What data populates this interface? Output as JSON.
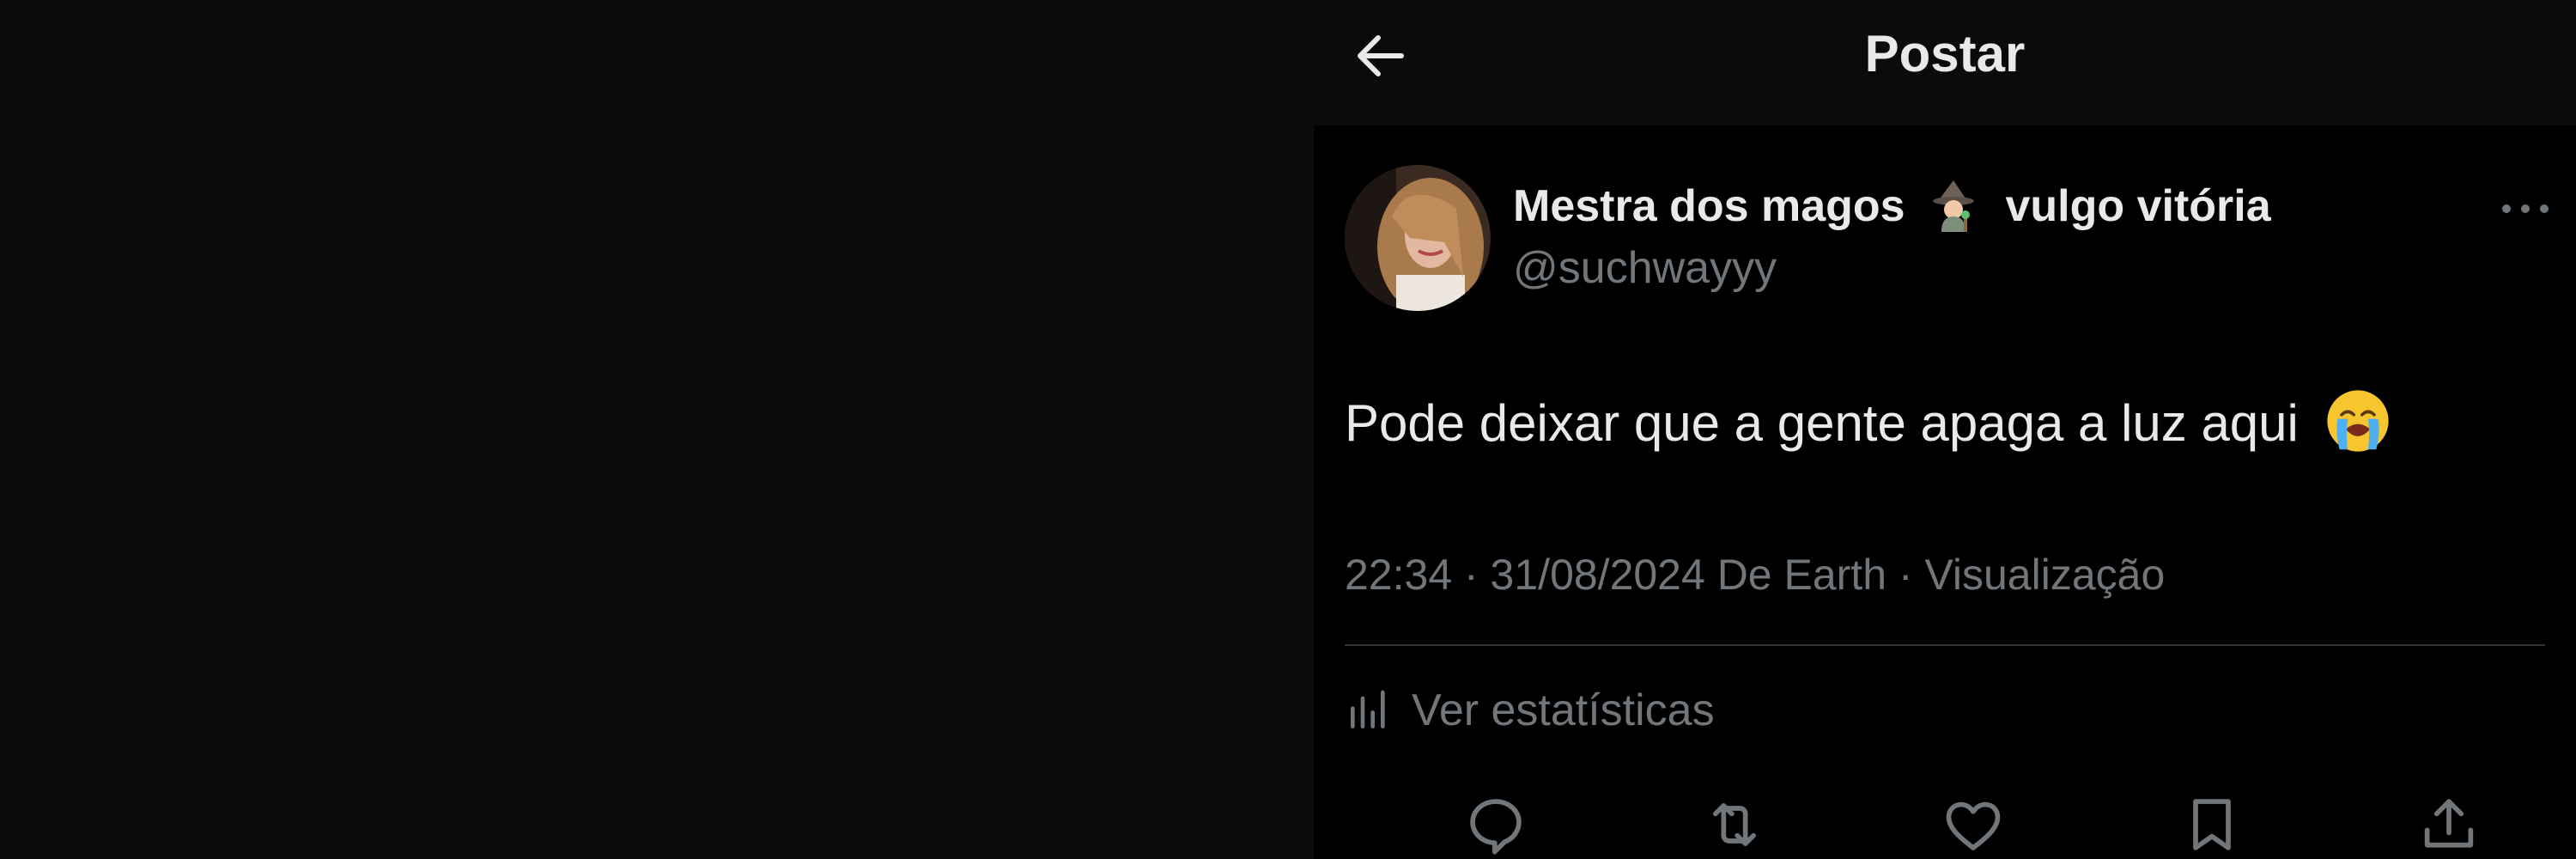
{
  "header": {
    "title": "Postar",
    "back_icon": "arrow-left-icon"
  },
  "post": {
    "author": {
      "display_name": "Mestra dos magos",
      "name_emoji": "woman-mage-emoji",
      "display_name_suffix": "vulgo vitória",
      "handle": "@suchwayyy"
    },
    "text": "Pode deixar que a gente apaga a luz aqui",
    "text_emoji": "loudly-crying-face-emoji",
    "meta": "22:34 · 31/08/2024 De Earth · Visualização",
    "stats_label": "Ver estatísticas"
  },
  "actions": [
    {
      "name": "reply",
      "icon": "comment-icon"
    },
    {
      "name": "repost",
      "icon": "repost-icon"
    },
    {
      "name": "like",
      "icon": "heart-icon"
    },
    {
      "name": "bookmark",
      "icon": "bookmark-icon"
    },
    {
      "name": "share",
      "icon": "share-icon"
    }
  ],
  "colors": {
    "background": "#000000",
    "panel": "#0b0b0b",
    "text_primary": "#e7e9ea",
    "text_secondary": "#71767b",
    "divider": "#2f3336"
  }
}
